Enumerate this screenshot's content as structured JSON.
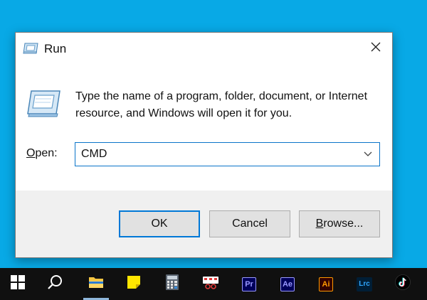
{
  "dialog": {
    "title": "Run",
    "description": "Type the name of a program, folder, document, or Internet resource, and Windows will open it for you.",
    "open_label_mnemonic": "O",
    "open_label_rest": "pen:",
    "input_value": "CMD",
    "buttons": {
      "ok": "OK",
      "cancel": "Cancel",
      "browse_mnemonic": "B",
      "browse_rest": "rowse..."
    }
  },
  "taskbar": {
    "items": [
      {
        "name": "start-icon",
        "active": false
      },
      {
        "name": "search-icon",
        "active": false
      },
      {
        "name": "file-explorer-icon",
        "active": true
      },
      {
        "name": "sticky-notes-icon",
        "active": false
      },
      {
        "name": "calculator-icon",
        "active": false
      },
      {
        "name": "snipping-tool-icon",
        "active": false
      },
      {
        "name": "premiere-pro-icon",
        "label": "Pr",
        "active": false
      },
      {
        "name": "after-effects-icon",
        "label": "Ae",
        "active": false
      },
      {
        "name": "illustrator-icon",
        "label": "Ai",
        "active": false
      },
      {
        "name": "lightroom-classic-icon",
        "label": "Lrc",
        "active": false
      },
      {
        "name": "tiktok-icon",
        "active": false
      }
    ]
  },
  "colors": {
    "desktop": "#08a9e6",
    "accent": "#0078d7",
    "taskbar": "#101010",
    "premiere": "#9999ff",
    "after_effects": "#9999ff",
    "illustrator": "#ff9a00",
    "lightroom": "#31a8ff"
  }
}
